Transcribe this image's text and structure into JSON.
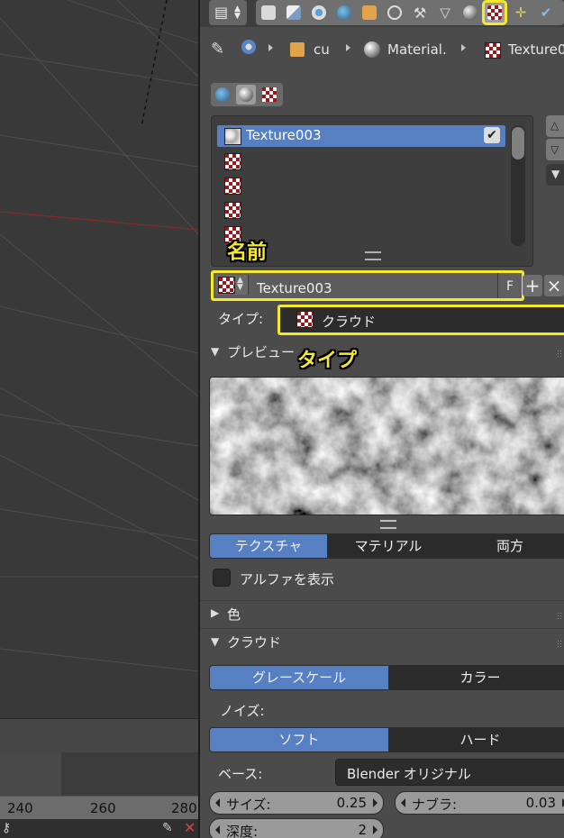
{
  "breadcrumb": {
    "object": "cu",
    "material": "Material.",
    "texture": "Texture0"
  },
  "slot_list": {
    "items": [
      {
        "label": "Texture003",
        "selected": true,
        "enabled": true
      },
      {
        "label": "",
        "selected": false
      },
      {
        "label": "",
        "selected": false
      },
      {
        "label": "",
        "selected": false
      },
      {
        "label": "",
        "selected": false
      }
    ]
  },
  "annotations": {
    "name": "名前",
    "type": "タイプ"
  },
  "texture_name": {
    "value": "Texture003",
    "fake_user_label": "F",
    "add_symbol": "+",
    "remove_symbol": "×"
  },
  "texture_type": {
    "label": "タイプ:",
    "value": "クラウド"
  },
  "preview": {
    "title": "プレビュー",
    "tabs": [
      "テクスチャ",
      "マテリアル",
      "両方"
    ],
    "active_tab": "テクスチャ",
    "show_alpha_label": "アルファを表示",
    "show_alpha_checked": false
  },
  "sections": {
    "color_title": "色",
    "clouds_title": "クラウド"
  },
  "clouds": {
    "color_modes": [
      "グレースケール",
      "カラー"
    ],
    "active_color_mode": "グレースケール",
    "noise_label": "ノイズ:",
    "noise_modes": [
      "ソフト",
      "ハード"
    ],
    "active_noise_mode": "ソフト",
    "basis_label": "ベース:",
    "basis_value": "Blender オリジナル",
    "size_label": "サイズ:",
    "size_value": "0.25",
    "nabla_label": "ナブラ:",
    "nabla_value": "0.03",
    "depth_label": "深度:",
    "depth_value": "2"
  },
  "timeline": {
    "ticks": [
      "240",
      "260",
      "280"
    ]
  },
  "colors": {
    "highlight": "#f5e92a",
    "selection": "#5680c2",
    "panel_bg": "#4b4b4b",
    "viewport_bg": "#393939"
  }
}
